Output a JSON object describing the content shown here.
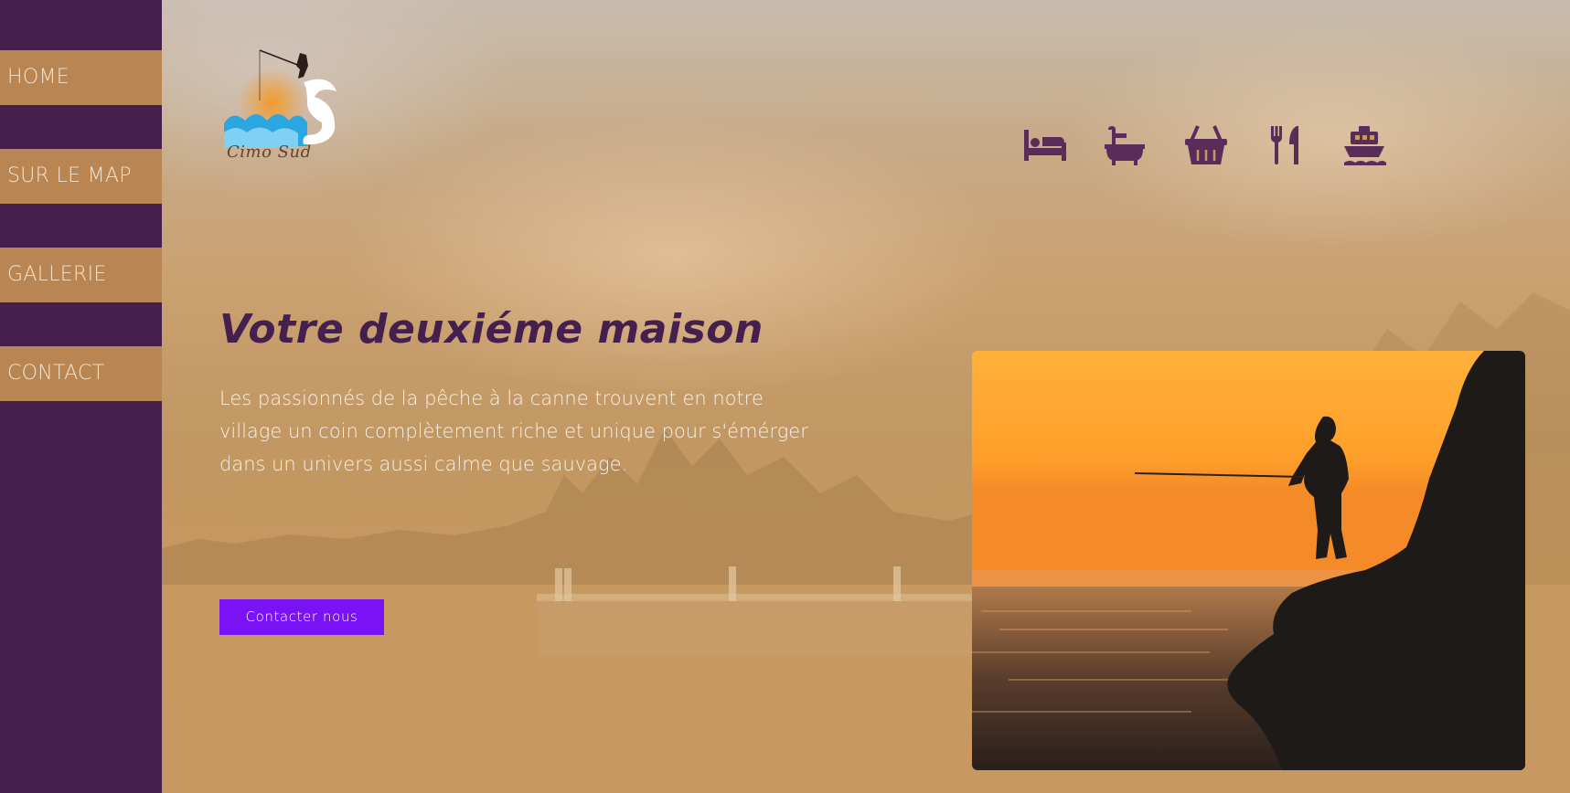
{
  "nav": {
    "items": [
      {
        "label": "HOME"
      },
      {
        "label": "SUR LE MAP"
      },
      {
        "label": "GALLERIE"
      },
      {
        "label": "CONTACT"
      }
    ]
  },
  "logo": {
    "text": "Cimo Sud"
  },
  "services": [
    {
      "icon": "bed-icon"
    },
    {
      "icon": "bathtub-icon"
    },
    {
      "icon": "shopping-basket-icon"
    },
    {
      "icon": "utensils-icon"
    },
    {
      "icon": "ship-icon"
    }
  ],
  "hero": {
    "title": "Votre deuxiéme maison",
    "description": "Les passionnés de la pêche à la canne trouvent en notre village un coin complètement riche et unique pour s'émérger dans un univers aussi calme que sauvage.",
    "cta_label": "Contacter nous"
  },
  "colors": {
    "sidebar": "#46204d",
    "nav_item": "#b98653",
    "accent_button": "#7a13f4",
    "title": "#45204f",
    "icon": "#5a2c5a"
  }
}
